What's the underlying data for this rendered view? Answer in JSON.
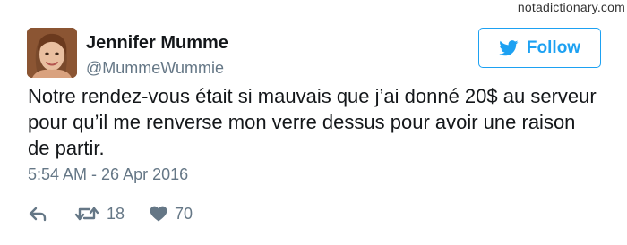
{
  "watermark": "notadictionary.com",
  "tweet": {
    "author": {
      "display_name": "Jennifer Mumme",
      "handle": "@MummeWummie",
      "avatar": "avatar"
    },
    "follow_label": "Follow",
    "text": "Notre rendez-vous était si mauvais que j’ai donné 20$ au serveur pour qu’il me renverse mon verre dessus pour avoir une raison de partir.",
    "timestamp": "5:54 AM - 26 Apr 2016",
    "actions": {
      "reply_icon": "reply-icon",
      "retweet_icon": "retweet-icon",
      "retweet_count": "18",
      "like_icon": "heart-icon",
      "like_count": "70"
    }
  },
  "colors": {
    "brand_blue": "#1da1f2",
    "secondary_text": "#657786",
    "primary_text": "#14171a"
  }
}
